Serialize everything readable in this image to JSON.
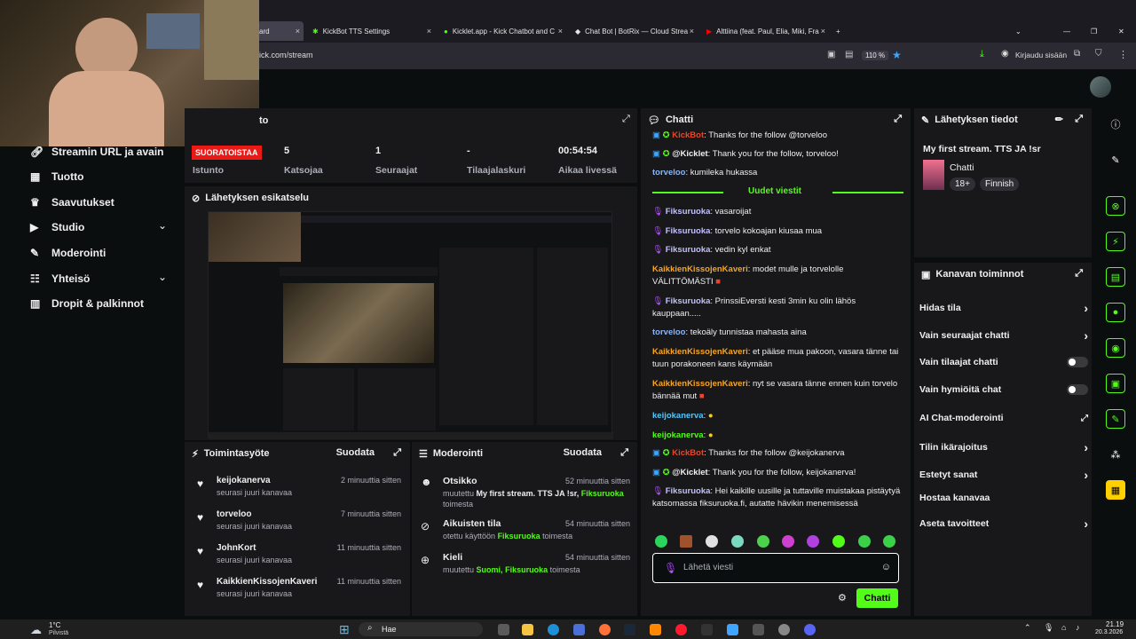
{
  "browser": {
    "tabs": [
      {
        "label": "ard",
        "active": true
      },
      {
        "label": "KickBot TTS Settings"
      },
      {
        "label": "Kicklet.app - Kick Chatbot and C"
      },
      {
        "label": "Chat Bot | BotRix — Cloud Strea"
      },
      {
        "label": "Alttiina (feat. Paul, Elia, Miki, Fra"
      }
    ],
    "url": "ick.com/stream",
    "zoom": "110 %",
    "signin": "Kirjaudu sisään"
  },
  "stats": {
    "live_badge": "SUORATOISTAA",
    "session_label": "Istunto",
    "viewers_value": "5",
    "viewers_label": "Katsojaa",
    "followers_value": "1",
    "followers_label": "Seuraajat",
    "subs_value": "-",
    "subs_label": "Tilaajalaskuri",
    "time_value": "00:54:54",
    "time_label": "Aikaa livessä",
    "header_tail": "to"
  },
  "leftnav": {
    "items": [
      {
        "label": "Streamin URL ja avain",
        "icon": "link-icon"
      },
      {
        "label": "Tuotto",
        "icon": "money-icon"
      },
      {
        "label": "Saavutukset",
        "icon": "trophy-icon"
      },
      {
        "label": "Studio",
        "icon": "camera-icon"
      },
      {
        "label": "Moderointi",
        "icon": "wrench-icon"
      },
      {
        "label": "Yhteisö",
        "icon": "people-icon"
      },
      {
        "label": "Dropit & palkinnot",
        "icon": "gift-icon"
      }
    ]
  },
  "preview": {
    "title": "Lähetyksen esikatselu"
  },
  "activity": {
    "title": "Toimintasyöte",
    "filter": "Suodata",
    "rows": [
      {
        "name": "keijokanerva",
        "sub": "seurasi juuri kanavaa",
        "time": "2 minuuttia sitten"
      },
      {
        "name": "torveloo",
        "sub": "seurasi juuri kanavaa",
        "time": "7 minuuttia sitten"
      },
      {
        "name": "JohnKort",
        "sub": "seurasi juuri kanavaa",
        "time": "11 minuuttia sitten"
      },
      {
        "name": "KaikkienKissojenKaveri",
        "sub": "seurasi juuri kanavaa",
        "time": "11 minuuttia sitten"
      }
    ]
  },
  "moderation": {
    "title": "Moderointi",
    "filter": "Suodata",
    "rows": [
      {
        "title": "Otsikko",
        "pre": "muutettu",
        "mid": "My first stream. TTS JA !sr,",
        "who": "Fiksuruoka",
        "post": "toimesta",
        "time": "52 minuuttia sitten"
      },
      {
        "title": "Aikuisten tila",
        "pre": "otettu käyttöön",
        "mid": "",
        "who": "Fiksuruoka",
        "post": "toimesta",
        "time": "54 minuuttia sitten"
      },
      {
        "title": "Kieli",
        "pre": "muutettu",
        "mid": "Suomi,",
        "who": "Fiksuruoka",
        "post": "toimesta",
        "time": "54 minuuttia sitten"
      }
    ]
  },
  "chat": {
    "title": "Chatti",
    "new_messages": "Uudet viestit",
    "placeholder": "Lähetä viesti",
    "send": "Chatti",
    "messages": [
      {
        "user": "KickBot",
        "text": "Thanks for the follow @torveloo",
        "color": "#e8462b"
      },
      {
        "user": "@Kicklet",
        "text": "Thank you for the follow, torveloo!",
        "color": "#efeff1"
      },
      {
        "user": "torveloo",
        "text": "kumileka hukassa",
        "color": "#8ab4f8"
      },
      {
        "user": "Fiksuruoka",
        "text": "vasaroijat",
        "color": "#c0c0ff"
      },
      {
        "user": "Fiksuruoka",
        "text": "torvelo kokoajan kiusaa mua",
        "color": "#c0c0ff"
      },
      {
        "user": "Fiksuruoka",
        "text": "vedin kyl enkat",
        "color": "#c0c0ff"
      },
      {
        "user": "KaikkienKissojenKaveri",
        "text": "modet mulle ja torvelolle VÄLITTÖMÄSTI",
        "color": "#f6a623"
      },
      {
        "user": "Fiksuruoka",
        "text": "PrinssiEversti kesti 3min ku olin lähös kauppaan.....",
        "color": "#c0c0ff"
      },
      {
        "user": "torveloo",
        "text": "tekoäly tunnistaa mahasta aina",
        "color": "#8ab4f8"
      },
      {
        "user": "KaikkienKissojenKaveri",
        "text": "et pääse mua pakoon, vasara tänne tai tuun porakoneen kans käymään",
        "color": "#f6a623"
      },
      {
        "user": "KaikkienKissojenKaveri",
        "text": "nyt se vasara tänne ennen kuin torvelo bännää mut",
        "color": "#f6a623"
      },
      {
        "user": "keijokanerva",
        "text": "",
        "color": "#53c7fc"
      },
      {
        "user": "keijokanerva",
        "text": "",
        "color": "#53fc18"
      },
      {
        "user": "KickBot",
        "text": "Thanks for the follow @keijokanerva",
        "color": "#e8462b"
      },
      {
        "user": "@Kicklet",
        "text": "Thank you for the follow, keijokanerva!",
        "color": "#efeff1"
      },
      {
        "user": "Fiksuruoka",
        "text": ": Hei kaikille uusille ja tuttaville muistakaa pistäytyä katsomassa fiksuruoka.fi, autatte hävikin menemisessä",
        "color": "#c0c0ff"
      }
    ]
  },
  "broadcast": {
    "title": "Lähetyksen tiedot",
    "stream_title": "My first stream. TTS JA !sr",
    "category": "Chatti",
    "tags": [
      "18+",
      "Finnish"
    ]
  },
  "actions": {
    "title": "Kanavan toiminnot",
    "items": [
      {
        "label": "Hidas tila",
        "ctrl": "chevron"
      },
      {
        "label": "Vain seuraajat chatti",
        "ctrl": "chevron"
      },
      {
        "label": "Vain tilaajat chatti",
        "ctrl": "toggle"
      },
      {
        "label": "Vain hymiöitä chat",
        "ctrl": "toggle"
      },
      {
        "label": "AI Chat-moderointi",
        "ctrl": "external"
      },
      {
        "label": "Tilin ikärajoitus",
        "ctrl": "chevron"
      },
      {
        "label": "Estetyt sanat",
        "ctrl": "chevron"
      },
      {
        "label": "Hostaa kanavaa",
        "ctrl": "none"
      },
      {
        "label": "Aseta tavoitteet",
        "ctrl": "chevron"
      }
    ]
  },
  "taskbar": {
    "weather_temp": "1°C",
    "weather_desc": "Pilvistä",
    "search": "Hae",
    "time": "21.19",
    "date": "20.3.2026"
  },
  "colors": {
    "accent": "#53fc18",
    "bg": "#0b0e0f",
    "panel": "#18181b",
    "live": "#e91916"
  }
}
